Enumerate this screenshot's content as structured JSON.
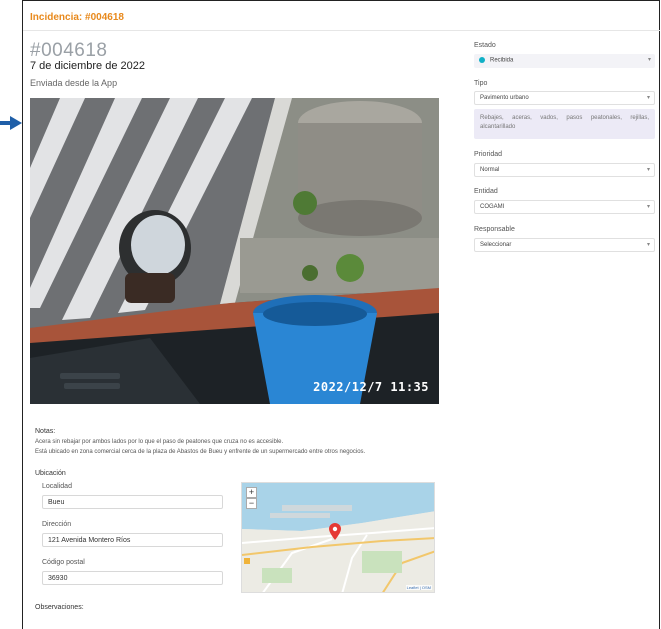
{
  "header": {
    "title": "Incidencia: #004618"
  },
  "incident": {
    "id": "#004618",
    "date": "7 de diciembre de 2022",
    "source": "Enviada desde la App",
    "photo_timestamp": "2022/12/7 11:35"
  },
  "notes": {
    "label": "Notas:",
    "lines": [
      "Acera sin rebajar por ambos lados por lo que el paso de peatones que cruza no es accesible.",
      "Está ubicado en zona comercial cerca de la plaza de Abastos de Bueu y enfrente de un supermercado entre otros negocios."
    ]
  },
  "location": {
    "label": "Ubicación",
    "localidad_label": "Localidad",
    "localidad": "Bueu",
    "direccion_label": "Dirección",
    "direccion": "121 Avenida Montero Ríos",
    "cp_label": "Código postal",
    "cp": "36930",
    "map": {
      "zoom_in": "+",
      "zoom_out": "−",
      "attribution": "Leaflet | OSM"
    }
  },
  "observaciones": {
    "label": "Observaciones:"
  },
  "sidebar": {
    "estado_label": "Estado",
    "estado_value": "Recibida",
    "estado_color": "#10b0c6",
    "tipo_label": "Tipo",
    "tipo_value": "Pavimento urbano",
    "subtipo_text": "Rebajes, aceras, vados, pasos peatonales, rejillas, alcantarillado",
    "prioridad_label": "Prioridad",
    "prioridad_value": "Normal",
    "entidad_label": "Entidad",
    "entidad_value": "COGAMI",
    "responsable_label": "Responsable",
    "responsable_value": "Seleccionar"
  },
  "colors": {
    "accent": "#e8891c",
    "muted": "#9aa0a6"
  },
  "icons": {
    "annotation_arrow": "arrow-right-icon",
    "map_pin": "map-pin-icon",
    "select_caret": "chevron-down-icon"
  }
}
